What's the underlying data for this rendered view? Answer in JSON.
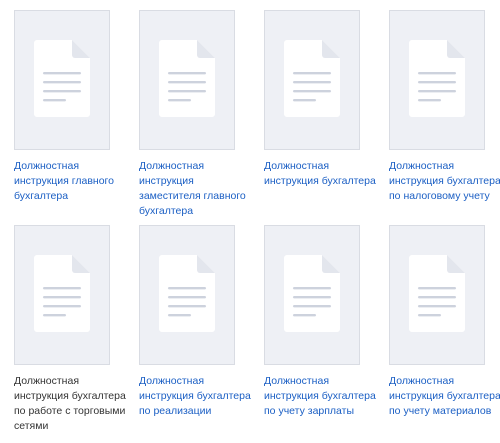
{
  "colors": {
    "link": "#1b5fc4",
    "plain_text": "#333333",
    "thumb_bg": "#eef0f5",
    "thumb_border": "#d9dce3",
    "doc_lines": "#cdd2dd"
  },
  "cards": [
    {
      "title": "Должностная инструкция главного бухгалтера",
      "icon": "document-icon",
      "link": true
    },
    {
      "title": "Должностная инструкция заместителя главного бухгалтера",
      "icon": "document-icon",
      "link": true
    },
    {
      "title": "Должностная инструкция бухгалтера",
      "icon": "document-icon",
      "link": true
    },
    {
      "title": "Должностная инструкция бухгалтера по налоговому учету",
      "icon": "document-icon",
      "link": true
    },
    {
      "title": "Должностная инструкция бухгалтера по работе с торговыми сетями",
      "icon": "document-icon",
      "link": false
    },
    {
      "title": "Должностная инструкция бухгалтера по реализации",
      "icon": "document-icon",
      "link": true
    },
    {
      "title": "Должностная инструкция бухгалтера по учету зарплаты",
      "icon": "document-icon",
      "link": true
    },
    {
      "title": "Должностная инструкция бухгалтера по учету материалов",
      "icon": "document-icon",
      "link": true
    }
  ]
}
